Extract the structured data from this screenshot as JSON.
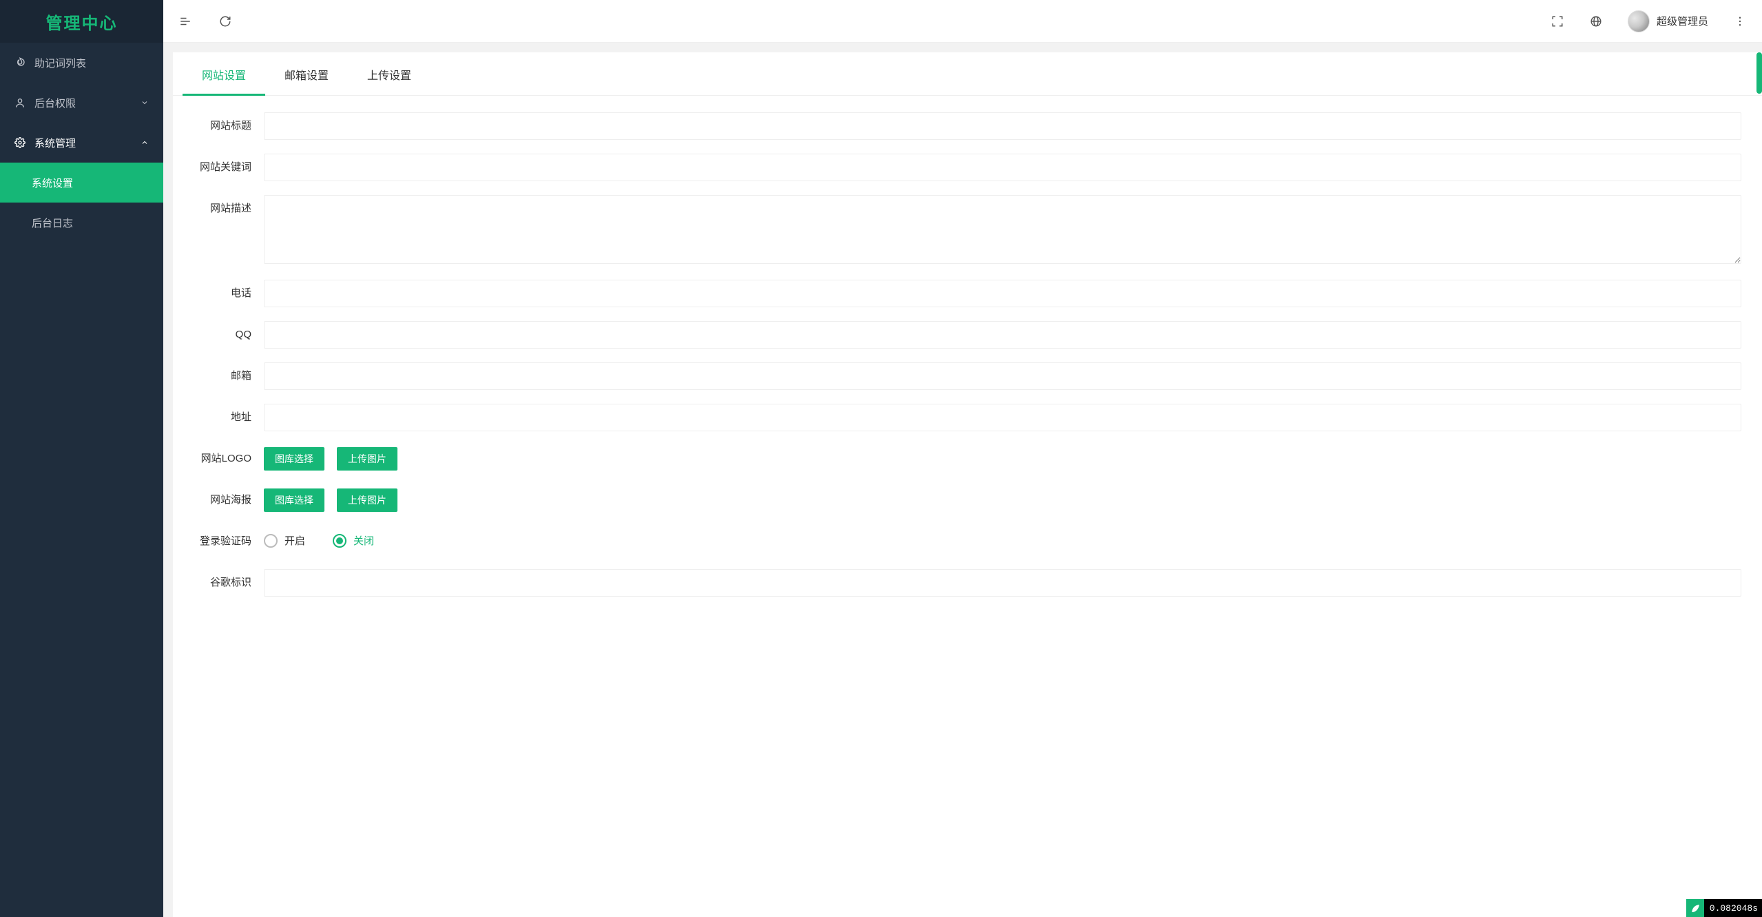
{
  "sidebar": {
    "logo": "管理中心",
    "items": [
      {
        "icon": "fire-icon",
        "label": "助记词列表",
        "arrow": false
      },
      {
        "icon": "user-icon",
        "label": "后台权限",
        "arrow": "down"
      },
      {
        "icon": "gear-icon",
        "label": "系统管理",
        "arrow": "up",
        "expanded": true,
        "children": [
          {
            "label": "系统设置",
            "active": true
          },
          {
            "label": "后台日志"
          }
        ]
      }
    ]
  },
  "topbar": {
    "user_name": "超级管理员"
  },
  "tabs": [
    {
      "label": "网站设置",
      "active": true
    },
    {
      "label": "邮箱设置"
    },
    {
      "label": "上传设置"
    }
  ],
  "form": {
    "site_title_label": "网站标题",
    "site_keywords_label": "网站关键词",
    "site_desc_label": "网站描述",
    "phone_label": "电话",
    "qq_label": "QQ",
    "email_label": "邮箱",
    "address_label": "地址",
    "logo_label": "网站LOGO",
    "poster_label": "网站海报",
    "captcha_label": "登录验证码",
    "google_label": "谷歌标识",
    "btn_gallery": "图库选择",
    "btn_upload": "上传图片",
    "radio_on": "开启",
    "radio_off": "关闭",
    "site_title": "",
    "site_keywords": "",
    "site_desc": "",
    "phone": "",
    "qq": "",
    "email": "",
    "address": "",
    "google": ""
  },
  "perf": {
    "time": "0.082048s"
  }
}
